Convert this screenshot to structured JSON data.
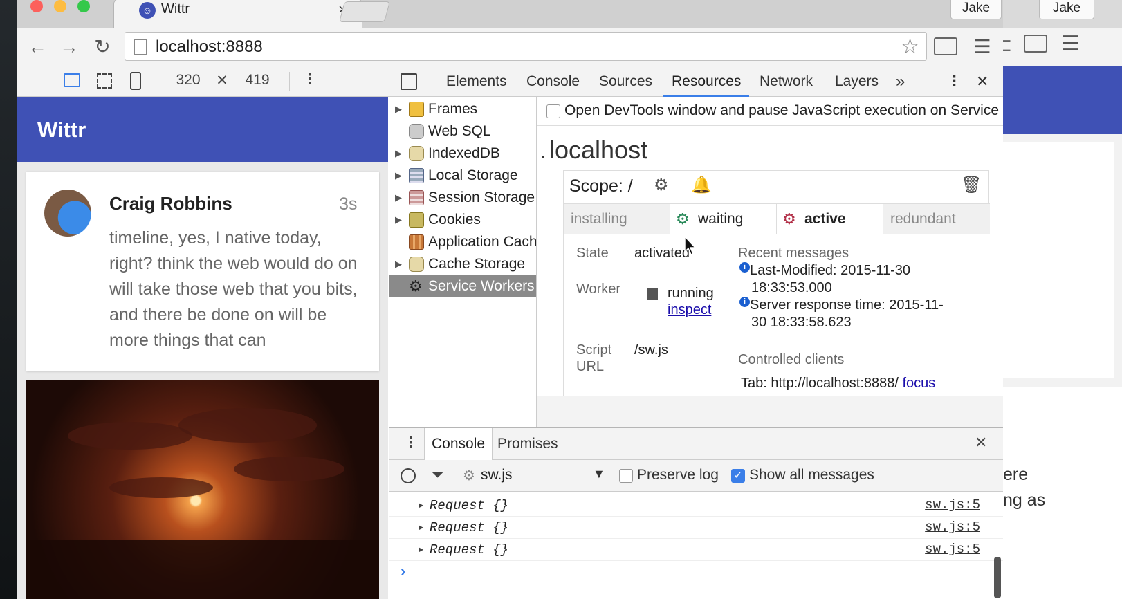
{
  "browser": {
    "tab_title": "Wittr",
    "tab_close": "×",
    "user": "Jake",
    "url": "localhost:8888",
    "back_window_user": "Jake"
  },
  "device_toolbar": {
    "width": "320",
    "times": "✕",
    "height": "419"
  },
  "app": {
    "title": "Wittr",
    "post": {
      "author": "Craig Robbins",
      "time": "3s",
      "body": "timeline, yes, I native today, right? think the web would do on will take those web that you bits, and there be done on will be more things that can"
    }
  },
  "devtools": {
    "tabs": [
      "Elements",
      "Console",
      "Sources",
      "Resources",
      "Network",
      "Layers"
    ],
    "active_tab": "Resources",
    "more": "»",
    "close": "✕",
    "sidebar": [
      {
        "label": "Frames",
        "expandable": true
      },
      {
        "label": "Web SQL",
        "expandable": false
      },
      {
        "label": "IndexedDB",
        "expandable": true
      },
      {
        "label": "Local Storage",
        "expandable": true
      },
      {
        "label": "Session Storage",
        "expandable": true
      },
      {
        "label": "Cookies",
        "expandable": true
      },
      {
        "label": "Application Cache",
        "expandable": false
      },
      {
        "label": "Cache Storage",
        "expandable": true
      },
      {
        "label": "Service Workers",
        "expandable": false,
        "selected": true
      }
    ],
    "pause_label": "Open DevTools window and pause JavaScript execution on Service Worker startup",
    "origin": "localhost",
    "origin_prefix": ".",
    "scope_label": "Scope: /",
    "sw_tabs": [
      "installing",
      "waiting",
      "active",
      "redundant"
    ],
    "state_label": "State",
    "state_value": "activated",
    "worker_label": "Worker",
    "worker_status": "running",
    "inspect_link": "inspect",
    "script_label_1": "Script",
    "script_label_2": "URL",
    "script_value": "/sw.js",
    "recent_messages_label": "Recent messages",
    "messages": [
      {
        "line1": "Last-Modified: 2015-11-30",
        "line2": "18:33:53.000"
      },
      {
        "line1": "Server response time: 2015-11-",
        "line2": "30 18:33:58.623"
      }
    ],
    "controlled_clients_label": "Controlled clients",
    "client": "Tab: http://localhost:8888/",
    "focus_link": "focus"
  },
  "console": {
    "tabs": [
      "Console",
      "Promises"
    ],
    "context": "sw.js",
    "preserve_log": "Preserve log",
    "show_all": "Show all messages",
    "logs": [
      {
        "msg": "Request {}",
        "src": "sw.js:5"
      },
      {
        "msg": "Request {}",
        "src": "sw.js:5"
      },
      {
        "msg": "Request {}",
        "src": "sw.js:5"
      }
    ],
    "prompt": "›"
  },
  "back_window_text": [
    "ere",
    "ng as"
  ],
  "colors": {
    "brand": "#3f51b5",
    "link": "#1a0dab",
    "active_tab_underline": "#3a7ee8"
  }
}
